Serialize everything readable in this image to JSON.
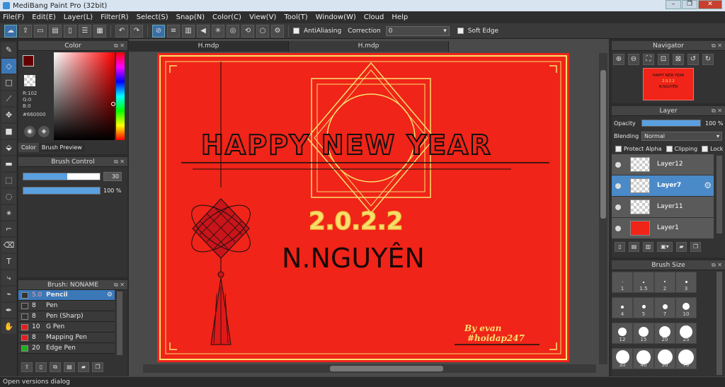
{
  "window": {
    "title": "MediBang Paint Pro (32bit)"
  },
  "menu": [
    "File(F)",
    "Edit(E)",
    "Layer(L)",
    "Filter(R)",
    "Select(S)",
    "Snap(N)",
    "Color(C)",
    "View(V)",
    "Tool(T)",
    "Window(W)",
    "Cloud",
    "Help"
  ],
  "toolbar": {
    "antialiasing_label": "AntiAliasing",
    "correction_label": "Correction",
    "correction_value": "0",
    "soft_edge_label": "Soft Edge"
  },
  "color_panel": {
    "title": "Color",
    "r": "R:102",
    "g": "G:0",
    "b": "B:0",
    "hex": "#660000",
    "tab_color": "Color",
    "tab_preview": "Brush Preview",
    "fg": "#660000",
    "bg": "#000000"
  },
  "brush_control": {
    "title": "Brush Control",
    "size_value": "30",
    "opacity_value": "100 %"
  },
  "brush_list": {
    "title": "Brush: NONAME",
    "items": [
      {
        "size": "5.0",
        "name": "Pencil",
        "color": "#333333"
      },
      {
        "size": "8",
        "name": "Pen",
        "color": "#333333"
      },
      {
        "size": "8",
        "name": "Pen (Sharp)",
        "color": "#333333"
      },
      {
        "size": "10",
        "name": "G Pen",
        "color": "#e02020"
      },
      {
        "size": "8",
        "name": "Mapping Pen",
        "color": "#e02020"
      },
      {
        "size": "20",
        "name": "Edge Pen",
        "color": "#20b020"
      }
    ]
  },
  "tabs": [
    "H.mdp",
    "H.mdp"
  ],
  "canvas": {
    "line1": "HAPPY NEW YEAR",
    "line2": "2.0.2.2",
    "line3": "N.NGUYÊN",
    "sig1": "By evan",
    "sig2": "#hoidap247"
  },
  "navigator": {
    "title": "Navigator",
    "thumb_text1": "HAPPY NEW YEAR",
    "thumb_text2": "2.0.2.2",
    "thumb_text3": "N.NGUYÊN"
  },
  "layer_panel": {
    "title": "Layer",
    "opacity_label": "Opacity",
    "opacity_value": "100 %",
    "blending_label": "Blending",
    "blending_value": "Normal",
    "protect_alpha": "Protect Alpha",
    "clipping": "Clipping",
    "lock": "Lock",
    "layers": [
      "Layer12",
      "Layer7",
      "Layer11",
      "Layer1"
    ]
  },
  "brush_size": {
    "title": "Brush Size",
    "sizes": [
      "1",
      "1.5",
      "2",
      "3",
      "4",
      "5",
      "7",
      "10",
      "12",
      "15",
      "20",
      "25",
      "30",
      "40",
      "50",
      "70"
    ]
  },
  "status": {
    "text": "Open versions dialog"
  }
}
